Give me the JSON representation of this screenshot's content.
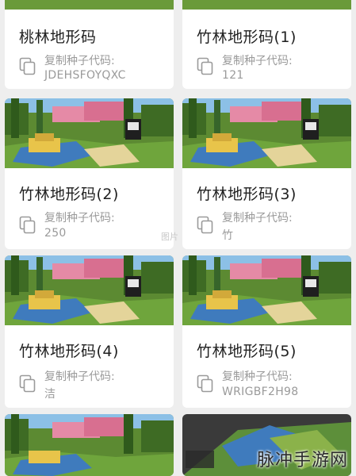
{
  "cards": [
    {
      "title": "桃林地形码",
      "code_label": "复制种子代码:",
      "code_value": "JDEHSFOYQXC"
    },
    {
      "title": "竹林地形码(1)",
      "code_label": "复制种子代码:",
      "code_value": "121"
    },
    {
      "title": "竹林地形码(2)",
      "code_label": "复制种子代码:",
      "code_value": "250"
    },
    {
      "title": "竹林地形码(3)",
      "code_label": "复制种子代码:",
      "code_value": "竹"
    },
    {
      "title": "竹林地形码(4)",
      "code_label": "复制种子代码:",
      "code_value": "洁"
    },
    {
      "title": "竹林地形码(5)",
      "code_label": "复制种子代码:",
      "code_value": "WRIGBF2H98"
    }
  ],
  "watermark": "脉冲手游网",
  "center_mark": "图片"
}
